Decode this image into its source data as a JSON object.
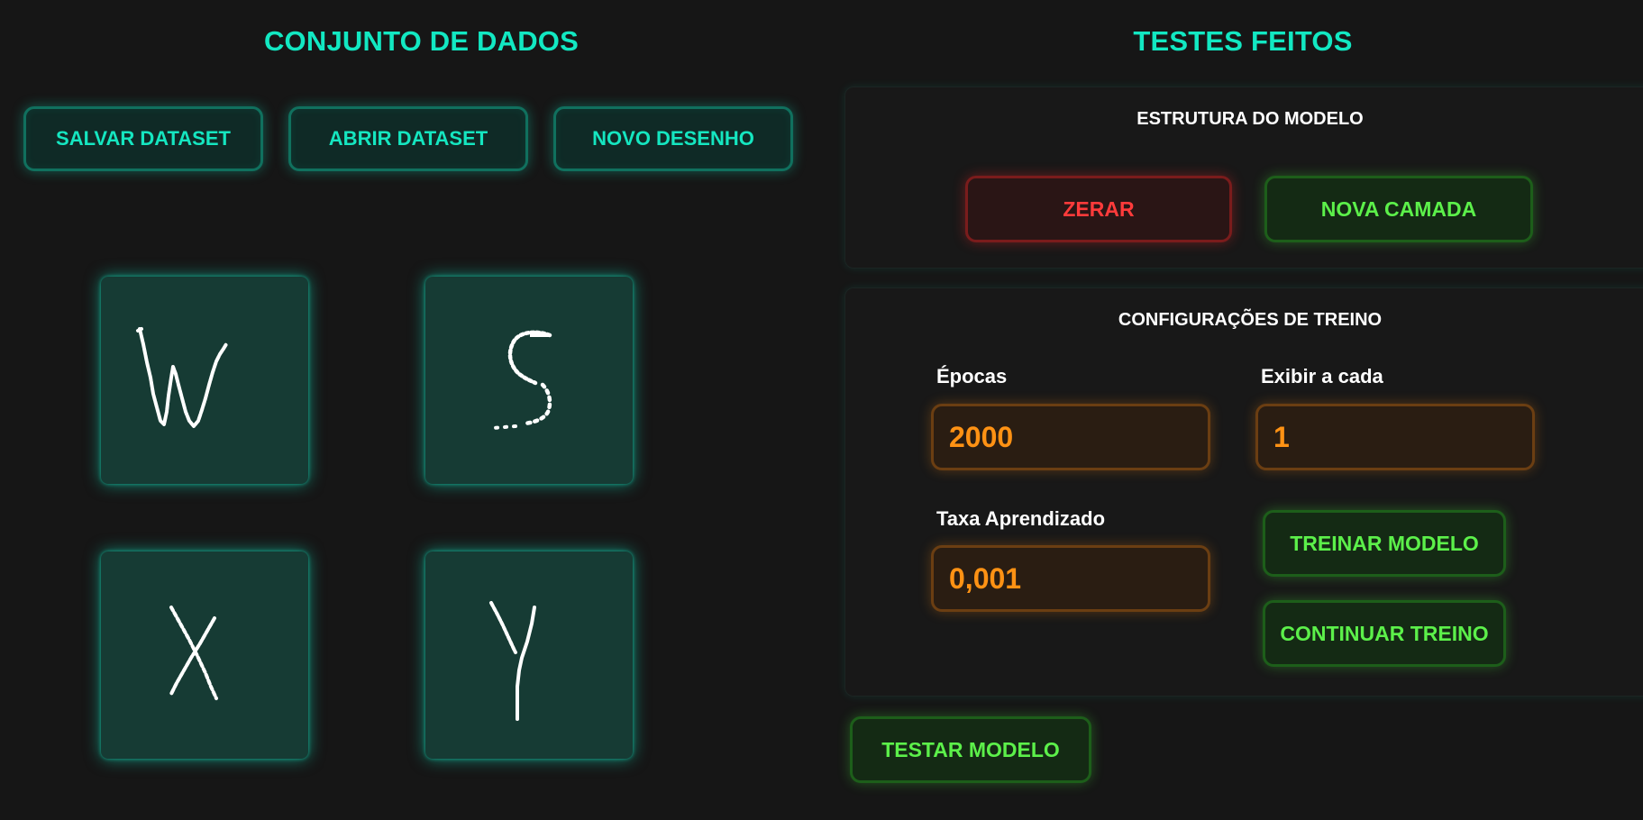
{
  "dataset": {
    "title": "CONJUNTO DE DADOS",
    "buttons": {
      "save": "SALVAR DATASET",
      "open": "ABRIR DATASET",
      "new": "NOVO DESENHO"
    },
    "drawings": [
      "W",
      "S",
      "X",
      "Y"
    ]
  },
  "tests": {
    "title": "TESTES FEITOS",
    "structure": {
      "title": "ESTRUTURA DO MODELO",
      "reset_label": "ZERAR",
      "new_layer_label": "NOVA CAMADA"
    },
    "training": {
      "title": "CONFIGURAÇÕES DE TREINO",
      "epochs_label": "Épocas",
      "epochs_value": "2000",
      "display_label": "Exibir a cada",
      "display_value": "1",
      "lr_label": "Taxa Aprendizado",
      "lr_value": "0,001",
      "train_label": "TREINAR MODELO",
      "continue_label": "CONTINUAR TREINO"
    },
    "test_label": "TESTAR MODELO"
  },
  "colors": {
    "background": "#161616",
    "teal_accent": "#12e8c2",
    "red_accent": "#ff3b3b",
    "green_accent": "#5cf04a",
    "orange_accent": "#ff9214"
  }
}
